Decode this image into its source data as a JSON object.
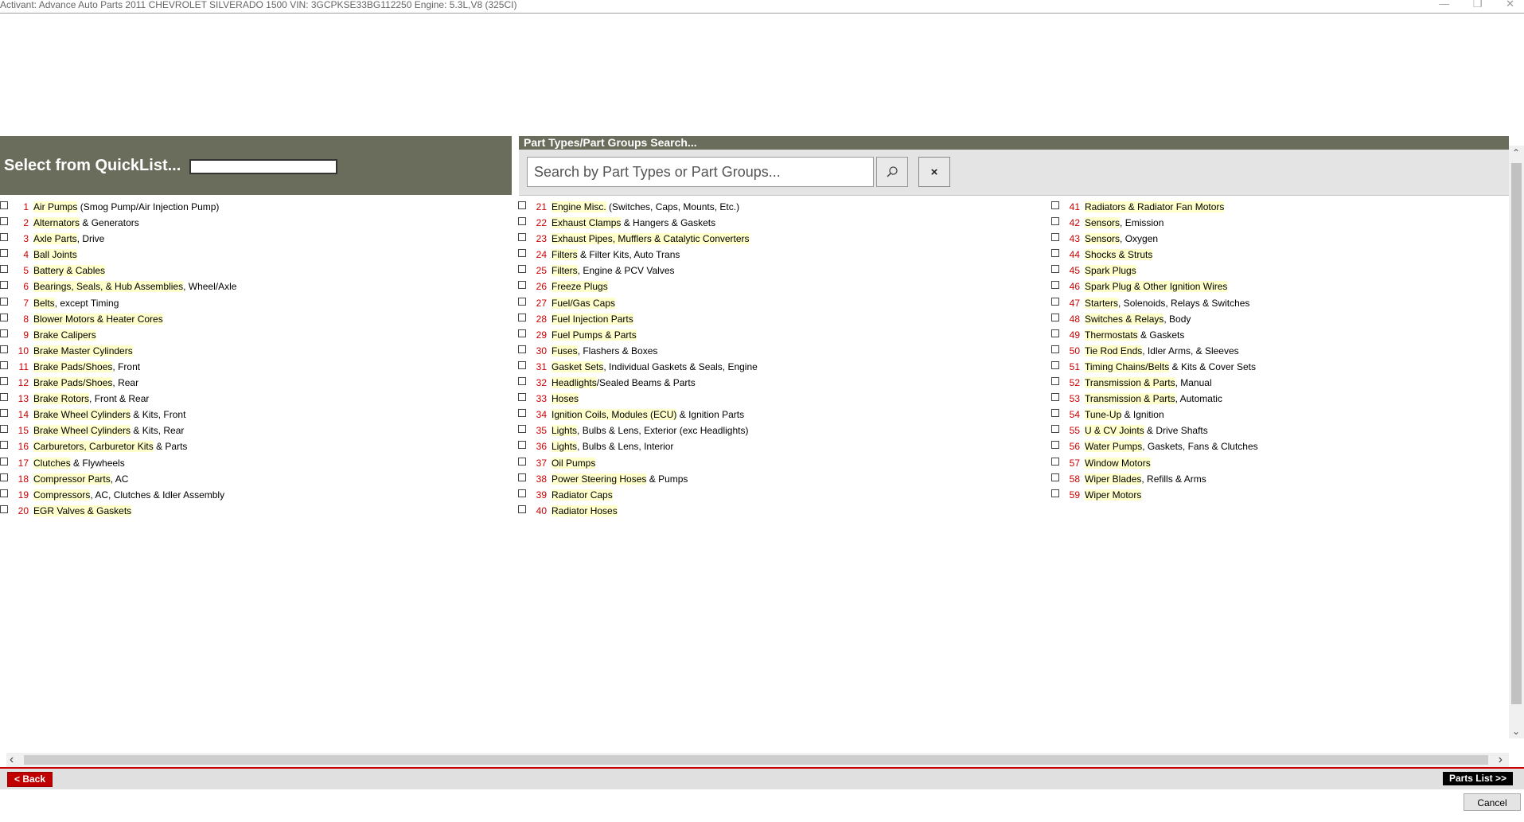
{
  "window": {
    "title": "Activant: Advance Auto Parts    2011 CHEVROLET SILVERADO   1500   VIN: 3GCPKSE33BG112250 Engine: 5.3L,V8 (325CI)"
  },
  "quicklist": {
    "label": "Select from QuickList...",
    "value": ""
  },
  "search": {
    "title": "Part Types/Part Groups Search...",
    "placeholder": "Search by Part Types or Part Groups...",
    "clear_label": "×"
  },
  "columns": [
    [
      {
        "num": "1",
        "parts": [
          {
            "t": "Air Pumps",
            "h": true
          },
          {
            "t": " (Smog Pump/Air Injection Pump)",
            "h": false
          }
        ]
      },
      {
        "num": "2",
        "parts": [
          {
            "t": "Alternators",
            "h": true
          },
          {
            "t": " & Generators",
            "h": false
          }
        ]
      },
      {
        "num": "3",
        "parts": [
          {
            "t": "Axle Parts",
            "h": true
          },
          {
            "t": ", Drive",
            "h": false
          }
        ]
      },
      {
        "num": "4",
        "parts": [
          {
            "t": "Ball Joints",
            "h": true
          }
        ]
      },
      {
        "num": "5",
        "parts": [
          {
            "t": "Battery & Cables",
            "h": true
          }
        ]
      },
      {
        "num": "6",
        "parts": [
          {
            "t": "Bearings, Seals, & Hub Assemblies",
            "h": true
          },
          {
            "t": ", Wheel/Axle",
            "h": false
          }
        ]
      },
      {
        "num": "7",
        "parts": [
          {
            "t": "Belts",
            "h": true
          },
          {
            "t": ", except Timing",
            "h": false
          }
        ]
      },
      {
        "num": "8",
        "parts": [
          {
            "t": "Blower Motors & Heater Cores",
            "h": true
          }
        ]
      },
      {
        "num": "9",
        "parts": [
          {
            "t": "Brake Calipers",
            "h": true
          }
        ]
      },
      {
        "num": "10",
        "parts": [
          {
            "t": "Brake Master Cylinders",
            "h": true
          }
        ]
      },
      {
        "num": "11",
        "parts": [
          {
            "t": "Brake Pads/Shoes",
            "h": true
          },
          {
            "t": ", Front",
            "h": false
          }
        ]
      },
      {
        "num": "12",
        "parts": [
          {
            "t": "Brake Pads/Shoes",
            "h": true
          },
          {
            "t": ", Rear",
            "h": false
          }
        ]
      },
      {
        "num": "13",
        "parts": [
          {
            "t": "Brake Rotors",
            "h": true
          },
          {
            "t": ", Front & Rear",
            "h": false
          }
        ]
      },
      {
        "num": "14",
        "parts": [
          {
            "t": "Brake Wheel Cylinders",
            "h": true
          },
          {
            "t": " & Kits, Front",
            "h": false
          }
        ]
      },
      {
        "num": "15",
        "parts": [
          {
            "t": "Brake Wheel Cylinders",
            "h": true
          },
          {
            "t": " & Kits, Rear",
            "h": false
          }
        ]
      },
      {
        "num": "16",
        "parts": [
          {
            "t": "Carburetors, Carburetor Kits",
            "h": true
          },
          {
            "t": " & Parts",
            "h": false
          }
        ]
      },
      {
        "num": "17",
        "parts": [
          {
            "t": "Clutches",
            "h": true
          },
          {
            "t": " & Flywheels",
            "h": false
          }
        ]
      },
      {
        "num": "18",
        "parts": [
          {
            "t": "Compressor Parts",
            "h": true
          },
          {
            "t": ", AC",
            "h": false
          }
        ]
      },
      {
        "num": "19",
        "parts": [
          {
            "t": "Compressors",
            "h": true
          },
          {
            "t": ", AC, Clutches & Idler Assembly",
            "h": false
          }
        ]
      },
      {
        "num": "20",
        "parts": [
          {
            "t": "EGR Valves & Gaskets",
            "h": true
          }
        ]
      }
    ],
    [
      {
        "num": "21",
        "parts": [
          {
            "t": "Engine Misc.",
            "h": true
          },
          {
            "t": " (Switches, Caps, Mounts, Etc.)",
            "h": false
          }
        ]
      },
      {
        "num": "22",
        "parts": [
          {
            "t": "Exhaust Clamps",
            "h": true
          },
          {
            "t": " & Hangers & Gaskets",
            "h": false
          }
        ]
      },
      {
        "num": "23",
        "parts": [
          {
            "t": "Exhaust Pipes, Mufflers & Catalytic Converters",
            "h": true
          }
        ]
      },
      {
        "num": "24",
        "parts": [
          {
            "t": "Filters",
            "h": true
          },
          {
            "t": " & Filter Kits, Auto Trans",
            "h": false
          }
        ]
      },
      {
        "num": "25",
        "parts": [
          {
            "t": "Filters",
            "h": true
          },
          {
            "t": ", Engine & PCV Valves",
            "h": false
          }
        ]
      },
      {
        "num": "26",
        "parts": [
          {
            "t": "Freeze Plugs",
            "h": true
          }
        ]
      },
      {
        "num": "27",
        "parts": [
          {
            "t": "Fuel/Gas Caps",
            "h": true
          }
        ]
      },
      {
        "num": "28",
        "parts": [
          {
            "t": "Fuel Injection Parts",
            "h": true
          }
        ]
      },
      {
        "num": "29",
        "parts": [
          {
            "t": "Fuel Pumps & Parts",
            "h": true
          }
        ]
      },
      {
        "num": "30",
        "parts": [
          {
            "t": "Fuses",
            "h": true
          },
          {
            "t": ", Flashers & Boxes",
            "h": false
          }
        ]
      },
      {
        "num": "31",
        "parts": [
          {
            "t": "Gasket Sets",
            "h": true
          },
          {
            "t": ", Individual Gaskets & Seals, Engine",
            "h": false
          }
        ]
      },
      {
        "num": "32",
        "parts": [
          {
            "t": "Headlights",
            "h": true
          },
          {
            "t": "/Sealed Beams & Parts",
            "h": false
          }
        ]
      },
      {
        "num": "33",
        "parts": [
          {
            "t": "Hoses",
            "h": true
          }
        ]
      },
      {
        "num": "34",
        "parts": [
          {
            "t": "Ignition Coils, Modules (ECU)",
            "h": true
          },
          {
            "t": " & Ignition Parts",
            "h": false
          }
        ]
      },
      {
        "num": "35",
        "parts": [
          {
            "t": "Lights",
            "h": true
          },
          {
            "t": ", Bulbs & Lens, Exterior (exc Headlights)",
            "h": false
          }
        ]
      },
      {
        "num": "36",
        "parts": [
          {
            "t": "Lights",
            "h": true
          },
          {
            "t": ", Bulbs & Lens, Interior",
            "h": false
          }
        ]
      },
      {
        "num": "37",
        "parts": [
          {
            "t": "Oil Pumps",
            "h": true
          }
        ]
      },
      {
        "num": "38",
        "parts": [
          {
            "t": "Power Steering Hoses",
            "h": true
          },
          {
            "t": " & Pumps",
            "h": false
          }
        ]
      },
      {
        "num": "39",
        "parts": [
          {
            "t": "Radiator Caps",
            "h": true
          }
        ]
      },
      {
        "num": "40",
        "parts": [
          {
            "t": "Radiator Hoses",
            "h": true
          }
        ]
      }
    ],
    [
      {
        "num": "41",
        "parts": [
          {
            "t": "Radiators & Radiator Fan Motors",
            "h": true
          }
        ]
      },
      {
        "num": "42",
        "parts": [
          {
            "t": "Sensors",
            "h": true
          },
          {
            "t": ", Emission",
            "h": false
          }
        ]
      },
      {
        "num": "43",
        "parts": [
          {
            "t": "Sensors",
            "h": true
          },
          {
            "t": ", Oxygen",
            "h": false
          }
        ]
      },
      {
        "num": "44",
        "parts": [
          {
            "t": "Shocks & Struts",
            "h": true
          }
        ]
      },
      {
        "num": "45",
        "parts": [
          {
            "t": "Spark Plugs",
            "h": true
          }
        ]
      },
      {
        "num": "46",
        "parts": [
          {
            "t": "Spark Plug & Other Ignition Wires",
            "h": true
          }
        ]
      },
      {
        "num": "47",
        "parts": [
          {
            "t": "Starters",
            "h": true
          },
          {
            "t": ", Solenoids, Relays & Switches",
            "h": false
          }
        ]
      },
      {
        "num": "48",
        "parts": [
          {
            "t": "Switches & Relays",
            "h": true
          },
          {
            "t": ", Body",
            "h": false
          }
        ]
      },
      {
        "num": "49",
        "parts": [
          {
            "t": "Thermostats",
            "h": true
          },
          {
            "t": " & Gaskets",
            "h": false
          }
        ]
      },
      {
        "num": "50",
        "parts": [
          {
            "t": "Tie Rod Ends",
            "h": true
          },
          {
            "t": ", Idler Arms, & Sleeves",
            "h": false
          }
        ]
      },
      {
        "num": "51",
        "parts": [
          {
            "t": "Timing Chains/Belts",
            "h": true
          },
          {
            "t": " & Kits & Cover Sets",
            "h": false
          }
        ]
      },
      {
        "num": "52",
        "parts": [
          {
            "t": "Transmission & Parts",
            "h": true
          },
          {
            "t": ", Manual",
            "h": false
          }
        ]
      },
      {
        "num": "53",
        "parts": [
          {
            "t": "Transmission & Parts",
            "h": true
          },
          {
            "t": ", Automatic",
            "h": false
          }
        ]
      },
      {
        "num": "54",
        "parts": [
          {
            "t": "Tune-Up",
            "h": true
          },
          {
            "t": " & Ignition",
            "h": false
          }
        ]
      },
      {
        "num": "55",
        "parts": [
          {
            "t": "U & CV Joints",
            "h": true
          },
          {
            "t": " & Drive Shafts",
            "h": false
          }
        ]
      },
      {
        "num": "56",
        "parts": [
          {
            "t": "Water Pumps",
            "h": true
          },
          {
            "t": ", Gaskets, Fans & Clutches",
            "h": false
          }
        ]
      },
      {
        "num": "57",
        "parts": [
          {
            "t": "Window Motors",
            "h": true
          }
        ]
      },
      {
        "num": "58",
        "parts": [
          {
            "t": "Wiper Blades",
            "h": true
          },
          {
            "t": ", Refills & Arms",
            "h": false
          }
        ]
      },
      {
        "num": "59",
        "parts": [
          {
            "t": "Wiper Motors",
            "h": true
          }
        ]
      }
    ]
  ],
  "nav": {
    "back_label": "< Back",
    "parts_list_label": "Parts List >>"
  },
  "footer": {
    "cancel_label": "Cancel"
  },
  "colors": {
    "header_bg": "#6a6c5c",
    "number_red": "#cc0000",
    "highlight": "#ffffcc",
    "back_red": "#c00000"
  }
}
